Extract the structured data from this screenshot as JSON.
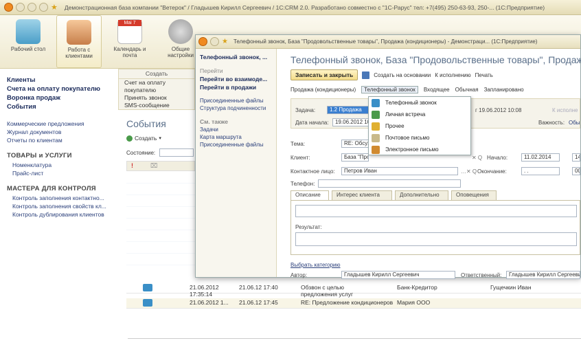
{
  "main_title": "Демонстрационная база компании \"Ветерок\" / Гладышев Кирилл Сергеевич / 1С:CRM 2.0. Разработано совместно с \"1С-Рарус\" тел: +7(495) 250-63-93, 250-... (1С:Предприятие)",
  "sections": [
    {
      "label": "Рабочий стол",
      "icon": "desk-icon"
    },
    {
      "label": "Работа с клиентами",
      "icon": "clients-icon"
    },
    {
      "label": "Календарь и почта",
      "icon": "calendar-icon",
      "badge": "Mai 7"
    },
    {
      "label": "Общие настройки",
      "icon": "gears-icon"
    }
  ],
  "leftnav": {
    "primary": [
      "Клиенты",
      "Счета на оплату покупателю",
      "Воронка продаж",
      "События"
    ],
    "secondary": [
      "Коммерческие предложения",
      "Журнал документов",
      "Отчеты по клиентам"
    ],
    "goods_head": "ТОВАРЫ и УСЛУГИ",
    "goods": [
      "Номенклатура",
      "Прайс-лист"
    ],
    "control_head": "МАСТЕРА ДЛЯ КОНТРОЛЯ",
    "control": [
      "Контроль заполнения контактно...",
      "Контроль заполнения свойств кл...",
      "Контроль дублирования клиентов"
    ]
  },
  "create_panel": {
    "title": "Создать",
    "items": [
      "Счет на оплату покупателю",
      "Принять звонок",
      "SMS-сообщение"
    ]
  },
  "events": {
    "title": "События",
    "create_label": "Создать",
    "state_label": "Состояние:",
    "rows": [
      {
        "date": "21.06.2012 17:35:14",
        "date2": "21.06.12 17:40",
        "subject": "Обзвон с целью предложения услуг",
        "client": "Банк-Кредитор",
        "author": "Гущечкин Иван"
      },
      {
        "date": "21.06.2012 1...",
        "date2": "21.06.12 17:45",
        "subject": "RE: Предложение кондиционеров",
        "client": "Мария ООО",
        "author": ""
      }
    ]
  },
  "dialog": {
    "window_title": "Телефонный звонок, База \"Продовольственные товары\", Продажа (кондиционеры) - Демонстраци... (1С:Предприятие)",
    "left": {
      "current": "Телефонный звонок, ...",
      "goto_head": "Перейти",
      "goto_items": [
        "Перейти во взаимоде...",
        "Перейти в продажи"
      ],
      "links": [
        "Присоединенные файлы",
        "Структура подчиненности"
      ],
      "see_also_head": "См. также",
      "see_also": [
        "Задачи",
        "Карта маршрута",
        "Присоединенные файлы"
      ]
    },
    "title": "Телефонный звонок, База \"Продовольственные товары\", Продажа",
    "toolbar": {
      "save_close": "Записать и закрыть",
      "create_basis": "Создать на основании",
      "to_execute": "К исполнению",
      "print": "Печать"
    },
    "toolbar2": {
      "sale": "Продажа (кондиционеры)",
      "type": "Телефонный звонок",
      "incoming": "Входящее",
      "normal": "Обычная",
      "planned": "Запланировано"
    },
    "task_label": "Задача:",
    "task_value": "1.2 Продажа",
    "task_date": "г 19.06.2012 10:08",
    "to_exec_link": "К исполне",
    "start_label": "Дата начала:",
    "start_value": "19.06.2012 10",
    "importance_label": "Важность:",
    "importance_value": "Обы",
    "topic_label": "Тема:",
    "topic_value": "RE: Обсуж",
    "client_label": "Клиент:",
    "client_value": "База \"Про",
    "begin_label": "Начало:",
    "begin_value": "11.02.2014",
    "begin_time": "14",
    "contact_label": "Контактное лицо:",
    "contact_value": "Петров Иван",
    "end_label": "Окончание:",
    "end_value": ". .",
    "end_time": "00",
    "phone_label": "Телефон:",
    "tabs": [
      "Описание",
      "Интерес клиента",
      "Дополнительно",
      "Оповещения"
    ],
    "result_label": "Результат:",
    "choose_category": "Выбрать категорию",
    "author_label": "Автор:",
    "author_value": "Гладышев Кирилл Сергеевич",
    "responsible_label": "Ответственный:",
    "responsible_value": "Гладышев Кирилл Сергееви"
  },
  "type_menu": [
    {
      "label": "Телефонный звонок",
      "icon": "phone-icon",
      "color": "#3a8fc7"
    },
    {
      "label": "Личная встреча",
      "icon": "meeting-icon",
      "color": "#4a9a4a"
    },
    {
      "label": "Прочее",
      "icon": "other-icon",
      "color": "#e0b030"
    },
    {
      "label": "Почтовое письмо",
      "icon": "letter-icon",
      "color": "#c9b98a"
    },
    {
      "label": "Электронное письмо",
      "icon": "email-icon",
      "color": "#d08a30"
    }
  ]
}
